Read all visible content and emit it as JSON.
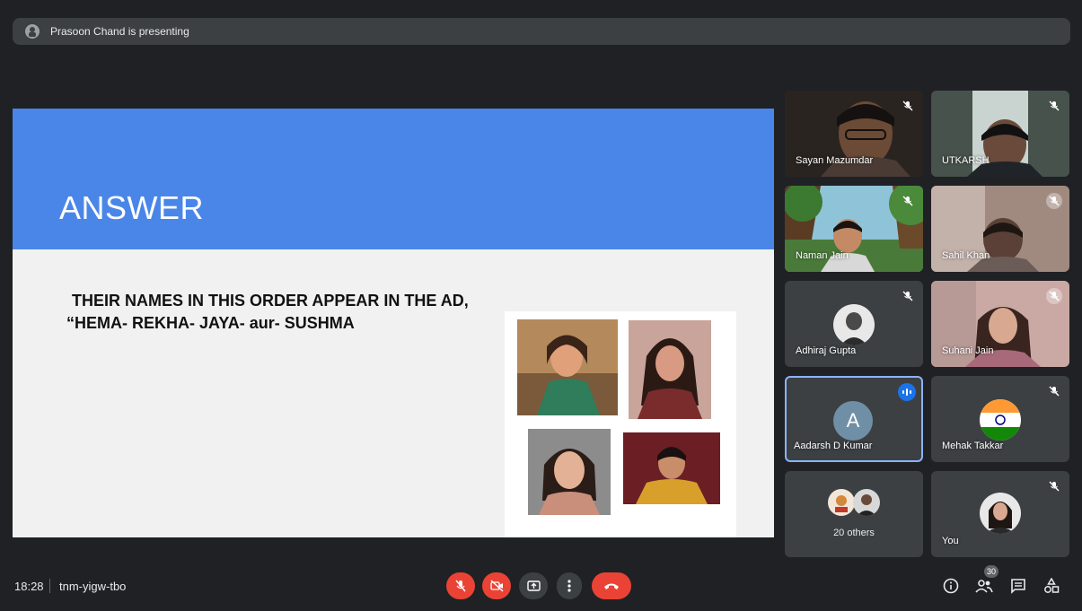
{
  "presenter": {
    "text": "Prasoon Chand is presenting"
  },
  "slide": {
    "title": "ANSWER",
    "line1": "THEIR NAMES IN THIS ORDER APPEAR IN THE AD,",
    "line2": "“HEMA- REKHA- JAYA- aur- SUSHMA"
  },
  "participants": [
    {
      "name": "Sayan Mazumdar",
      "muted": true
    },
    {
      "name": "UTKARSH",
      "muted": true
    },
    {
      "name": "Naman Jain",
      "muted": true
    },
    {
      "name": "Sahil Khan",
      "muted": true
    },
    {
      "name": "Adhiraj Gupta",
      "muted": true
    },
    {
      "name": "Suhani Jain",
      "muted": true
    },
    {
      "name": "Aadarsh D Kumar",
      "avatar_letter": "A",
      "speaking": true
    },
    {
      "name": "Mehak Takkar",
      "muted": true
    },
    {
      "others_label": "20 others"
    },
    {
      "name": "You",
      "muted": true
    }
  ],
  "bottom": {
    "time": "18:28",
    "meeting_code": "tnm-yigw-tbo",
    "people_count": "30"
  },
  "icons": {
    "mic": "mic-off-icon",
    "camera": "camera-off-icon",
    "present": "present-screen-icon",
    "more": "more-options-icon",
    "leave": "leave-call-icon",
    "info": "info-icon",
    "people": "people-icon",
    "chat": "chat-icon",
    "activities": "activities-icon"
  },
  "colors": {
    "background": "#202124",
    "slide_header": "#4a86e8",
    "danger": "#ea4335",
    "speaking": "#1a73e8",
    "active_border": "#8ab4f8"
  }
}
